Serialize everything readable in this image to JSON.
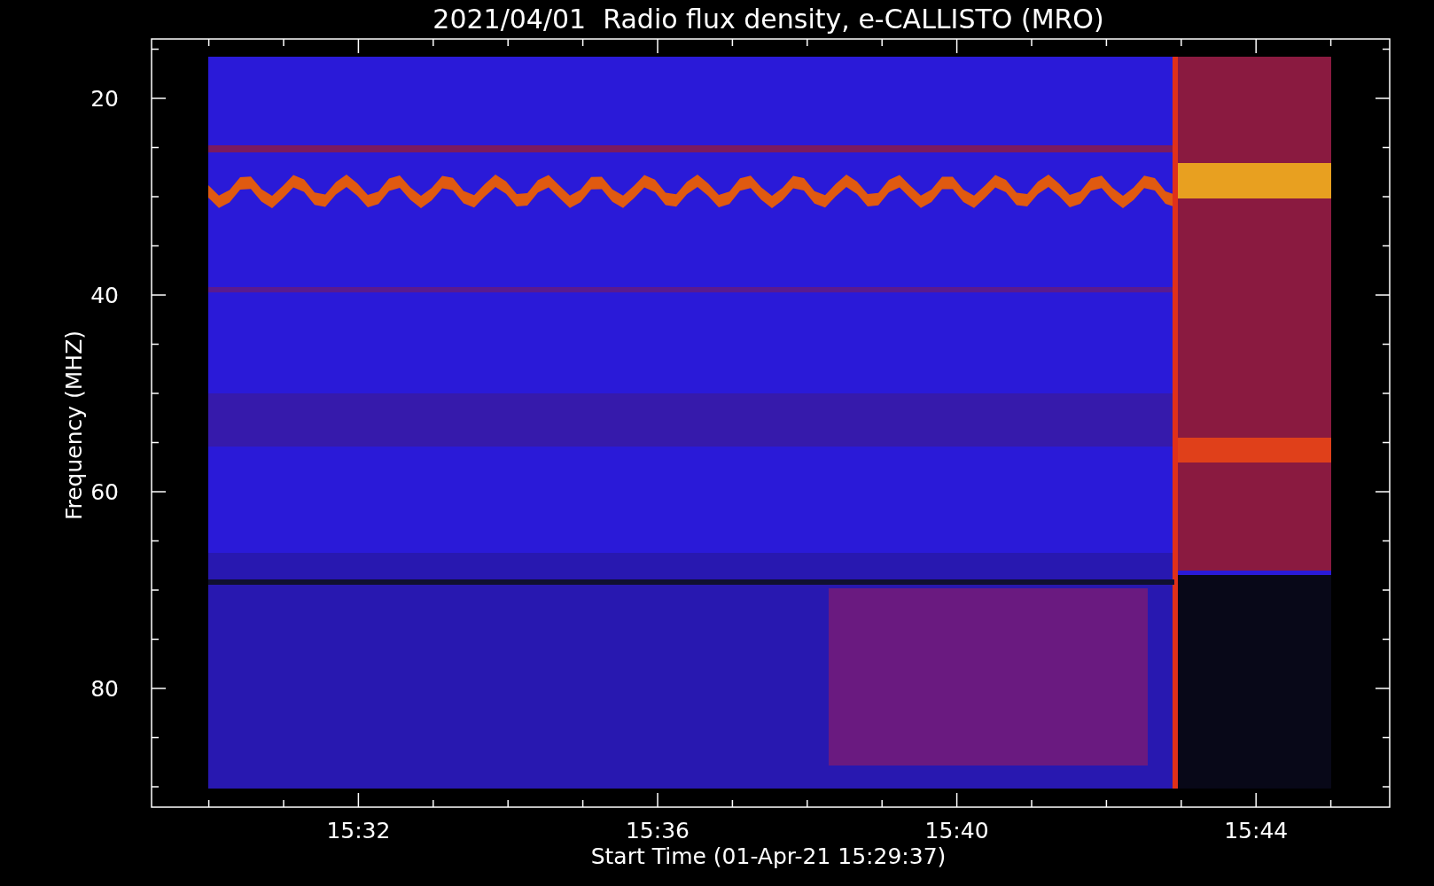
{
  "title": "2021/04/01  Radio flux density, e-CALLISTO (MRO)",
  "y_axis": {
    "label": "Frequency (MHZ)",
    "ticks": [
      "20",
      "40",
      "60",
      "80"
    ]
  },
  "x_axis": {
    "label": "Start Time (01-Apr-21 15:29:37)",
    "ticks": [
      "15:32",
      "15:36",
      "15:40",
      "15:44"
    ]
  }
}
